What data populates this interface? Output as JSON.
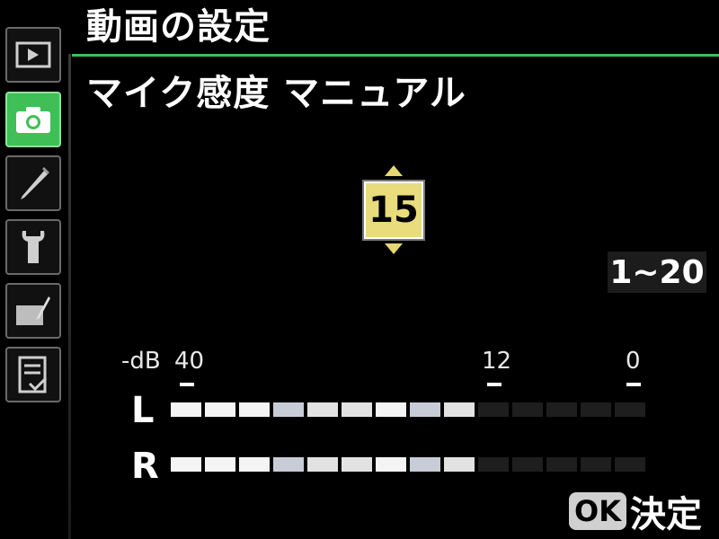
{
  "header": {
    "menu_title": "動画の設定",
    "setting_title": "マイク感度 マニュアル"
  },
  "sidebar": {
    "tabs": [
      {
        "icon": "playback-icon",
        "active": false
      },
      {
        "icon": "camera-icon",
        "active": true
      },
      {
        "icon": "pencil-icon",
        "active": false
      },
      {
        "icon": "wrench-icon",
        "active": false
      },
      {
        "icon": "retouch-icon",
        "active": false
      },
      {
        "icon": "recent-settings-icon",
        "active": false
      }
    ]
  },
  "selector": {
    "value": "15",
    "range": "1~20"
  },
  "meter": {
    "db_unit": "-dB",
    "db_40": "40",
    "db_12": "12",
    "db_0": "0",
    "left_label": "L",
    "right_label": "R",
    "segments_total": 14,
    "left_lit": 9,
    "right_lit": 9
  },
  "footer": {
    "ok_badge": "OK",
    "ok_text": "決定"
  },
  "colors": {
    "accent_green": "#3fbf55",
    "value_yellow": "#e8dc7c"
  }
}
